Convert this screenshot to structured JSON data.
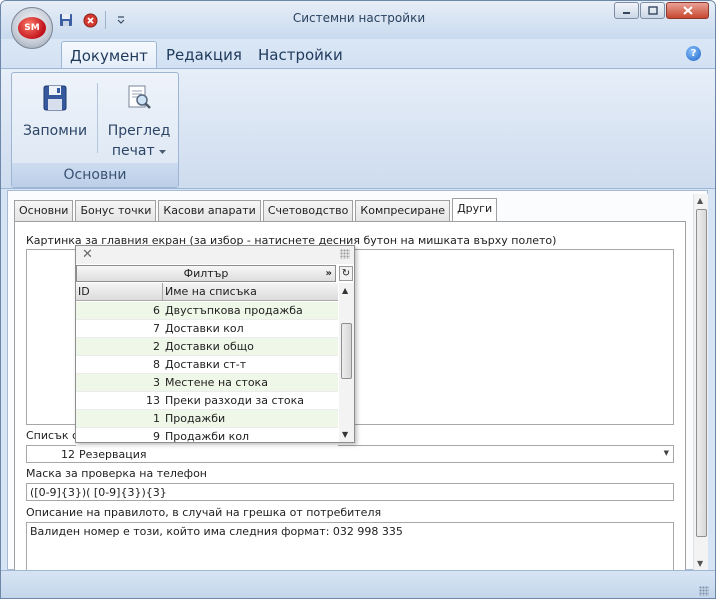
{
  "window": {
    "title": "Системни настройки",
    "app_logo": "SM"
  },
  "ribbon": {
    "tabs": [
      "Документ",
      "Редакция",
      "Настройки"
    ],
    "group_title": "Основни",
    "save_label": "Запомни",
    "preview_label_1": "Преглед",
    "preview_label_2": "печат"
  },
  "tabs": [
    "Основни",
    "Бонус точки",
    "Касови апарати",
    "Счетоводство",
    "Компресиране",
    "Други"
  ],
  "form": {
    "image_label": "Картинка за главния екран (за избор - натиснете десния бутон на мишката върху полето)",
    "list_label": "Списък с д",
    "list_id": "12",
    "list_value": "Резервация",
    "phone_mask_label": "Маска за проверка на телефон",
    "phone_mask_value": "([0-9]{3})( [0-9]{3}){3}",
    "rule_desc_label": "Описание на правилото, в случай на грешка от потребителя",
    "rule_desc_value": "Валиден номер е този, който има следния формат: 032 998 335"
  },
  "popup": {
    "filter_label": "Филтър",
    "col_id": "ID",
    "col_name": "Име на списъка",
    "rows": [
      {
        "id": "6",
        "name": "Двустъпкова продажба"
      },
      {
        "id": "7",
        "name": "Доставки кол"
      },
      {
        "id": "2",
        "name": "Доставки общо"
      },
      {
        "id": "8",
        "name": "Доставки ст-т"
      },
      {
        "id": "3",
        "name": "Местене на стока"
      },
      {
        "id": "13",
        "name": "Преки разходи за стока"
      },
      {
        "id": "1",
        "name": "Продажби"
      },
      {
        "id": "9",
        "name": "Продажби кол"
      }
    ]
  }
}
